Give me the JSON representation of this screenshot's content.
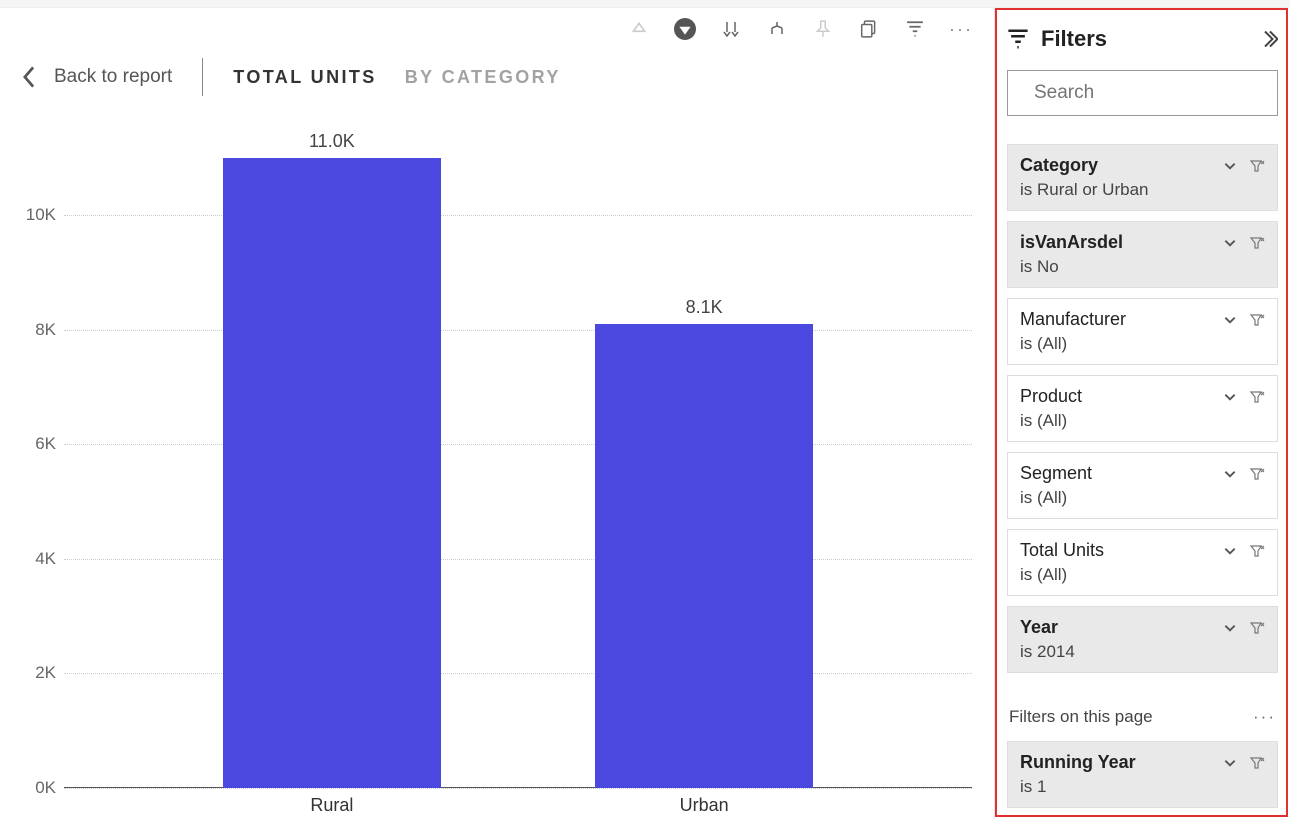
{
  "nav": {
    "back_label": "Back to report",
    "tabs": [
      {
        "id": "total-units",
        "label": "TOTAL UNITS",
        "active": true
      },
      {
        "id": "by-category",
        "label": "BY CATEGORY",
        "active": false
      }
    ]
  },
  "filters": {
    "title": "Filters",
    "search_placeholder": "Search",
    "cards": [
      {
        "title": "Category",
        "sub": "is Rural or Urban",
        "applied": true
      },
      {
        "title": "isVanArsdel",
        "sub": "is No",
        "applied": true
      },
      {
        "title": "Manufacturer",
        "sub": "is (All)",
        "applied": false
      },
      {
        "title": "Product",
        "sub": "is (All)",
        "applied": false
      },
      {
        "title": "Segment",
        "sub": "is (All)",
        "applied": false
      },
      {
        "title": "Total Units",
        "sub": "is (All)",
        "applied": false
      },
      {
        "title": "Year",
        "sub": "is 2014",
        "applied": true
      }
    ],
    "page_section_label": "Filters on this page",
    "page_cards": [
      {
        "title": "Running Year",
        "sub": "is 1",
        "applied": true
      }
    ]
  },
  "chart_data": {
    "type": "bar",
    "categories": [
      "Rural",
      "Urban"
    ],
    "values": [
      11000,
      8100
    ],
    "value_labels": [
      "11.0K",
      "8.1K"
    ],
    "ylim": [
      0,
      11000
    ],
    "yticks": [
      0,
      2000,
      4000,
      6000,
      8000,
      10000
    ],
    "ytick_labels": [
      "0K",
      "2K",
      "4K",
      "6K",
      "8K",
      "10K"
    ],
    "bar_color": "#4b48df"
  }
}
